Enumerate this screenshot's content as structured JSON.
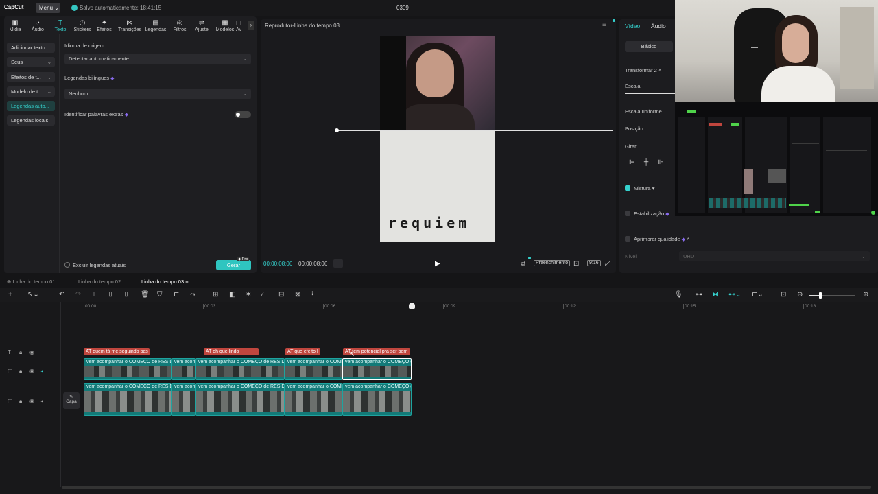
{
  "app": {
    "logo": "CapCut",
    "menu_label": "Menu",
    "save_status": "Salvo automaticamente: 18:41:15",
    "project_title": "0309"
  },
  "toolbar": {
    "tools": [
      {
        "label": "Mídia",
        "icon": "media-icon"
      },
      {
        "label": "Áudio",
        "icon": "audio-icon"
      },
      {
        "label": "Texto",
        "icon": "text-icon"
      },
      {
        "label": "Stickers",
        "icon": "sticker-icon"
      },
      {
        "label": "Efeitos",
        "icon": "effects-icon"
      },
      {
        "label": "Transições",
        "icon": "transitions-icon"
      },
      {
        "label": "Legendas",
        "icon": "captions-icon"
      },
      {
        "label": "Filtros",
        "icon": "filters-icon"
      },
      {
        "label": "Ajuste",
        "icon": "adjust-icon"
      },
      {
        "label": "Modelos",
        "icon": "templates-icon"
      },
      {
        "label": "Av",
        "icon": "more-icon"
      }
    ],
    "active": "Texto"
  },
  "text_sidebar": {
    "items": [
      {
        "label": "Adicionar texto"
      },
      {
        "label": "Seus"
      },
      {
        "label": "Efeitos de t..."
      },
      {
        "label": "Modelo de t..."
      },
      {
        "label": "Legendas auto..."
      },
      {
        "label": "Legendas locais"
      }
    ],
    "active": "Legendas auto..."
  },
  "captions_panel": {
    "source_language_label": "Idioma de origem",
    "source_language_value": "Detectar automaticamente",
    "bilingual_label": "Legendas bilíngues",
    "bilingual_value": "Nenhum",
    "extra_words_label": "Identificar palavras extras",
    "extra_words_enabled": false,
    "clear_current_label": "Excluir legendas atuais",
    "generate_label": "Gerar",
    "pro_badge": "Pro"
  },
  "player": {
    "title": "Reprodutor-Linha do tempo 03",
    "overlay_text": "requiem",
    "current_time": "00:00:08:06",
    "total_time": "00:00:08:06",
    "fill_label": "Preenchimento",
    "ratio_label": "9:16"
  },
  "inspector": {
    "tabs": [
      "Vídeo",
      "Áudio"
    ],
    "active_tab": "Vídeo",
    "basic_label": "Básico",
    "transform_label": "Transformar 2",
    "scale_label": "Escala",
    "uniform_scale_label": "Escala uniforme",
    "position_label": "Posição",
    "rotate_label": "Girar",
    "blend_label": "Mistura",
    "stabilize_label": "Estabilização",
    "enhance_label": "Aprimorar qualidade",
    "level_label": "Nível",
    "level_value": "UHD"
  },
  "timeline": {
    "tabs": [
      "Linha do tempo 01",
      "Linha do tempo 02",
      "Linha do tempo 03"
    ],
    "active_tab": "Linha do tempo 03",
    "ruler": [
      "00:00",
      "00:03",
      "00:06",
      "00:09",
      "00:12",
      "00:15",
      "00:18"
    ],
    "caption_clips": [
      "quem tá me seguindo pas",
      "oh que lindo",
      "que efeito l",
      "tem potencial pra ser bem"
    ],
    "video_clips_top": [
      "vem acompanhar o COMEÇO de RESIDE",
      "vem acom",
      "vem acompanhar o COMEÇO de RESIDE",
      "vem acompanhar o COME",
      "vem acompanhar o COMEÇO d"
    ],
    "video_clips_bottom": [
      "vem acompanhar o COMEÇO de RESIDE",
      "vem acom",
      "vem acompanhar o COMEÇO de RESIDE",
      "vem acompanhar o COME",
      "vem acompanhar o COMEÇO d"
    ],
    "cover_label": "Capa"
  },
  "colors": {
    "accent": "#35d1cd",
    "caption_clip": "#c0463e",
    "video_clip": "#137a78",
    "pro_gem": "#8a6cf0"
  }
}
